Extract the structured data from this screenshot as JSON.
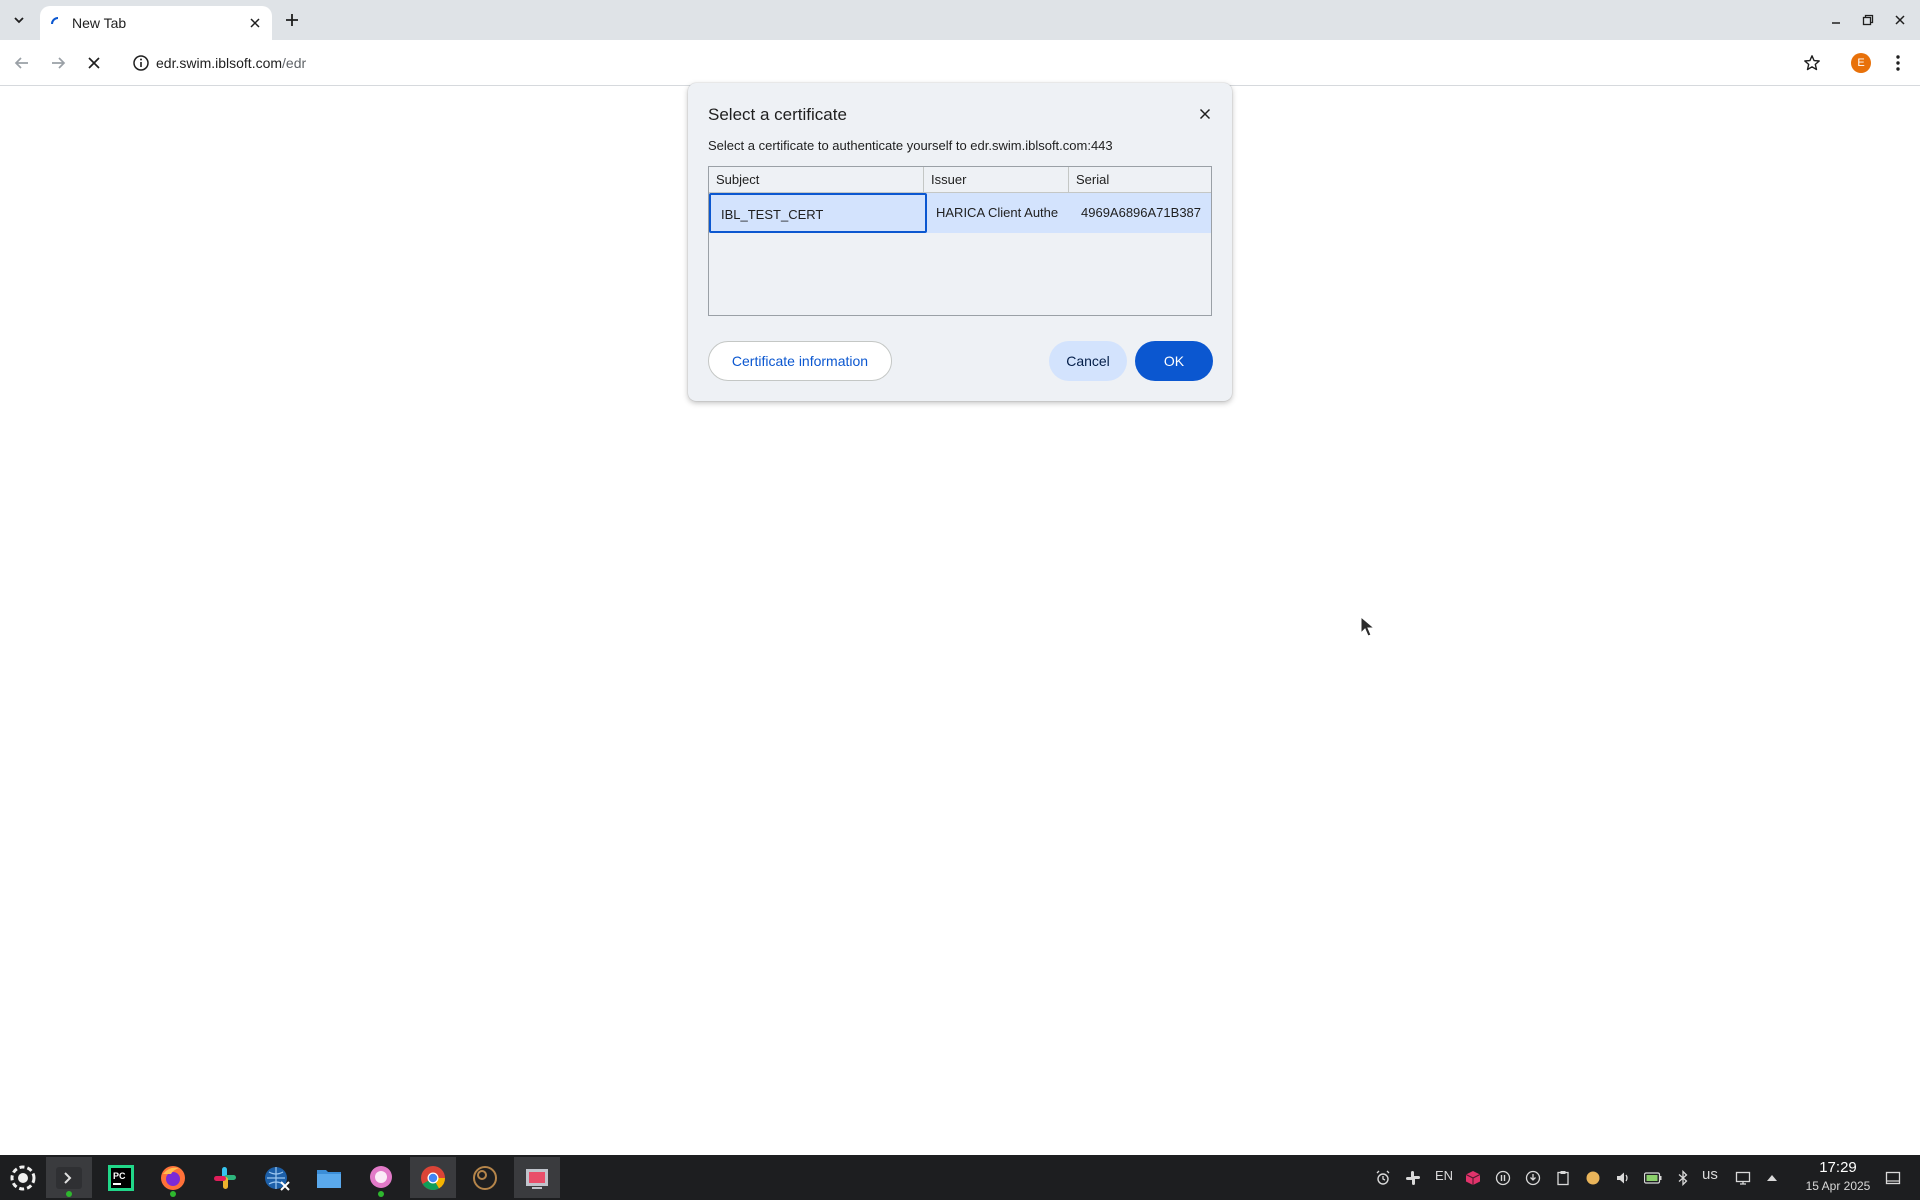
{
  "browser": {
    "tab_title": "New Tab",
    "url_host": "edr.swim.iblsoft.com",
    "url_path": "/edr",
    "profile_initial": "E"
  },
  "dialog": {
    "title": "Select a certificate",
    "description": "Select a certificate to authenticate yourself to edr.swim.iblsoft.com:443",
    "columns": [
      "Subject",
      "Issuer",
      "Serial"
    ],
    "rows": [
      {
        "subject": "IBL_TEST_CERT",
        "issuer": "HARICA Client Authe",
        "serial": "4969A6896A71B387"
      }
    ],
    "info_button": "Certificate information",
    "cancel_button": "Cancel",
    "ok_button": "OK"
  },
  "taskbar": {
    "apps": [
      "start-icon",
      "terminal-icon",
      "pycharm-icon",
      "firefox-icon",
      "slack-icon",
      "network-tool-icon",
      "files-icon",
      "messenger-icon",
      "chrome-icon",
      "gimp-icon",
      "screenshot-tool-icon"
    ],
    "lang": "EN",
    "keyboard": "us",
    "time": "17:29",
    "date": "15 Apr 2025"
  },
  "colors": {
    "accent": "#0b57d0",
    "selection": "#d3e3fd",
    "dialog_bg": "#eef1f5",
    "taskbar": "#1d1e20"
  }
}
